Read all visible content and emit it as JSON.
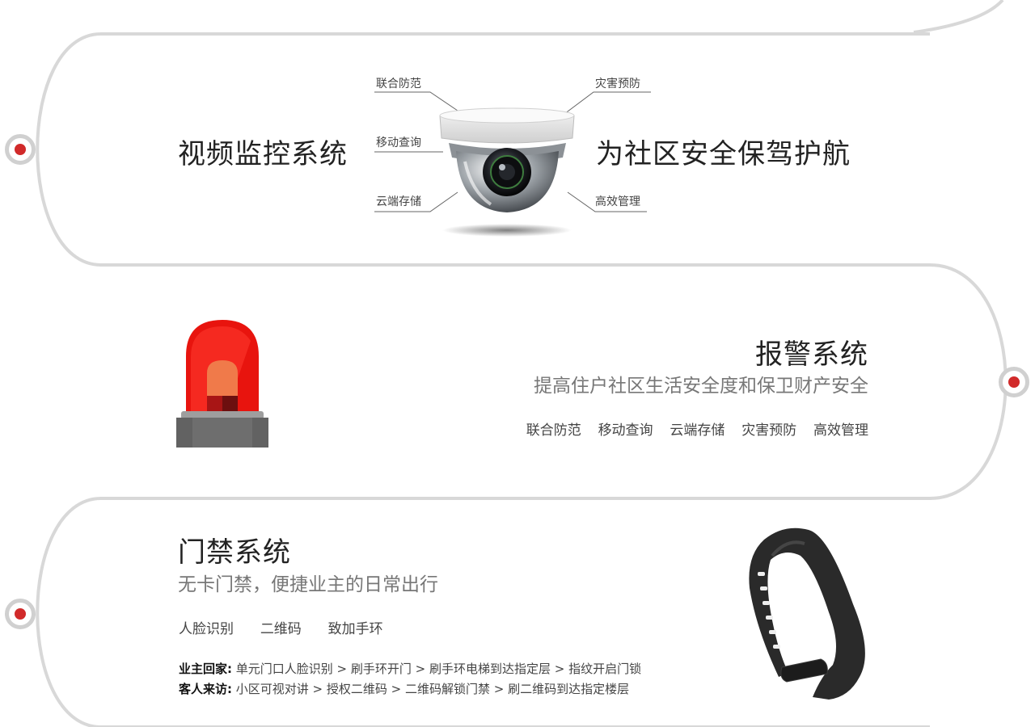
{
  "video": {
    "title": "视频监控系统",
    "slogan": "为社区安全保驾护航",
    "labels": {
      "top_left": "联合防范",
      "mid_left": "移动查询",
      "bottom_left": "云端存储",
      "top_right": "灾害预防",
      "bottom_right": "高效管理"
    }
  },
  "alarm": {
    "title": "报警系统",
    "subtitle": "提高住户社区生活安全度和保卫财产安全",
    "features": [
      "联合防范",
      "移动查询",
      "云端存储",
      "灾害预防",
      "高效管理"
    ]
  },
  "access": {
    "title": "门禁系统",
    "subtitle": "无卡门禁，便捷业主的日常出行",
    "features": [
      "人脸识别",
      "二维码",
      "致加手环"
    ],
    "owner": {
      "label": "业主回家:",
      "flow": "单元门口人脸识别 > 刷手环开门 > 刷手环电梯到达指定层 > 指纹开启门锁"
    },
    "guest": {
      "label": "客人来访:",
      "flow": "小区可视对讲 > 授权二维码  > 二维码解锁门禁  >  刷二维码到达指定楼层"
    }
  },
  "colors": {
    "accent": "#d12a2a",
    "track": "#d8d8d8"
  }
}
